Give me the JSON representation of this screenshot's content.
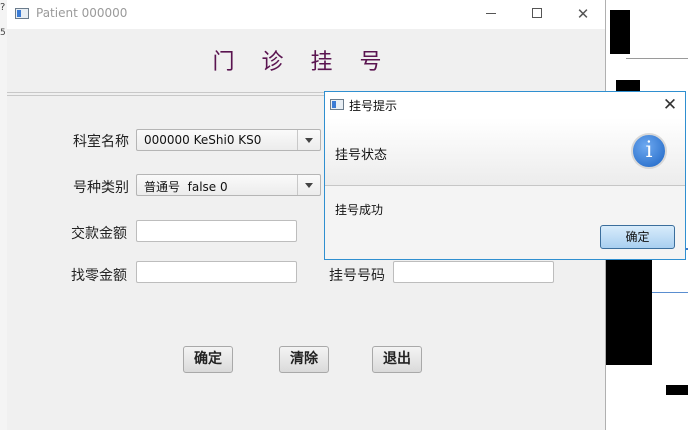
{
  "window": {
    "title": "Patient 000000",
    "minimize": "—",
    "maximize": "☐",
    "close": "✕"
  },
  "form": {
    "heading": "门 诊 挂 号",
    "dept_label": "科室名称",
    "dept_value": "000000 KeShi0 KS0",
    "regtype_label": "号种类别",
    "regtype_value": "普通号  false 0",
    "payment_label": "交款金额",
    "payment_value": "",
    "change_label": "找零金额",
    "change_value": "",
    "regnum_label": "挂号号码",
    "regnum_value": ""
  },
  "buttons": {
    "confirm": "确定",
    "clear": "清除",
    "exit": "退出"
  },
  "dialog": {
    "title": "挂号提示",
    "close": "✕",
    "header": "挂号状态",
    "icon": "info-icon",
    "message": "挂号成功",
    "ok": "确定"
  },
  "colors": {
    "heading": "#5a1450",
    "dialog_border": "#2f8fd0",
    "info_icon": "#1c64c4"
  }
}
